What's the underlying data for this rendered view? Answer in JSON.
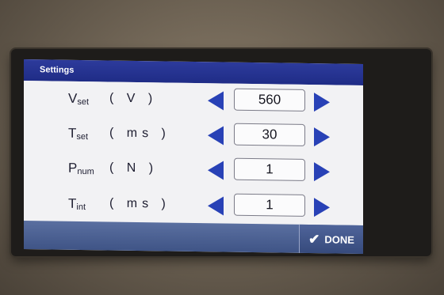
{
  "window": {
    "title": "Settings"
  },
  "settings": [
    {
      "symbol": "V",
      "subscript": "set",
      "unit": "( V )",
      "value": "560"
    },
    {
      "symbol": "T",
      "subscript": "set",
      "unit": "( ms )",
      "value": "30"
    },
    {
      "symbol": "P",
      "subscript": "num",
      "unit": "( N )",
      "value": "1"
    },
    {
      "symbol": "T",
      "subscript": "int",
      "unit": "( ms )",
      "value": "1"
    }
  ],
  "footer": {
    "done_label": "DONE",
    "done_icon": "check-icon"
  },
  "colors": {
    "title_bar": "#23318f",
    "arrow": "#2841b6",
    "footer": "#4a5f92"
  }
}
